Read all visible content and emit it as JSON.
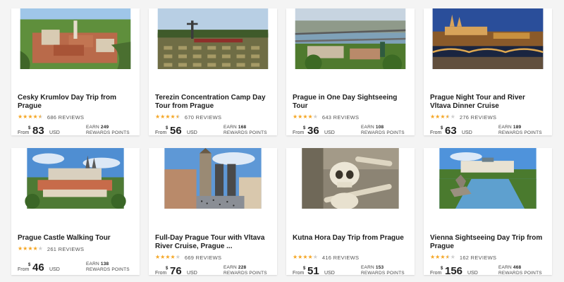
{
  "labels": {
    "from": "From",
    "currency": "USD",
    "currency_symbol": "$",
    "earn": "EARN",
    "points": "REWARDS POINTS",
    "reviews_suffix": "REVIEWS"
  },
  "colors": {
    "star_filled": "#f5a623",
    "star_empty": "#cfcfcf",
    "card_bg": "#ffffff",
    "page_bg": "#f4f4f4"
  },
  "tours": [
    {
      "title": "Cesky Krumlov Day Trip from Prague",
      "rating": 4.5,
      "reviews": "686 REVIEWS",
      "price": "83",
      "points": "249",
      "image": "cesky-krumlov-town-photo"
    },
    {
      "title": "Terezin Concentration Camp Day Tour from Prague",
      "rating": 4.5,
      "reviews": "670 REVIEWS",
      "price": "56",
      "points": "168",
      "image": "terezin-cemetery-photo"
    },
    {
      "title": "Prague in One Day Sightseeing Tour",
      "rating": 4,
      "reviews": "643 REVIEWS",
      "price": "36",
      "points": "108",
      "image": "prague-bridges-photo"
    },
    {
      "title": "Prague Night Tour and River Vltava Dinner Cruise",
      "rating": 3.5,
      "reviews": "276 REVIEWS",
      "price": "63",
      "points": "189",
      "image": "prague-castle-night-photo"
    },
    {
      "title": "Prague Castle Walking Tour",
      "rating": 4,
      "reviews": "261 REVIEWS",
      "price": "46",
      "points": "138",
      "image": "prague-castle-day-photo"
    },
    {
      "title": "Full-Day Prague Tour with Vltava River Cruise, Prague ...",
      "rating": 4,
      "reviews": "669 REVIEWS",
      "price": "76",
      "points": "228",
      "image": "old-town-square-photo"
    },
    {
      "title": "Kutna Hora Day Trip from Prague",
      "rating": 4,
      "reviews": "416 REVIEWS",
      "price": "51",
      "points": "153",
      "image": "bone-skull-photo"
    },
    {
      "title": "Vienna Sightseeing Day Trip from Prague",
      "rating": 3.5,
      "reviews": "162 REVIEWS",
      "price": "156",
      "points": "468",
      "image": "belvedere-palace-photo"
    }
  ]
}
